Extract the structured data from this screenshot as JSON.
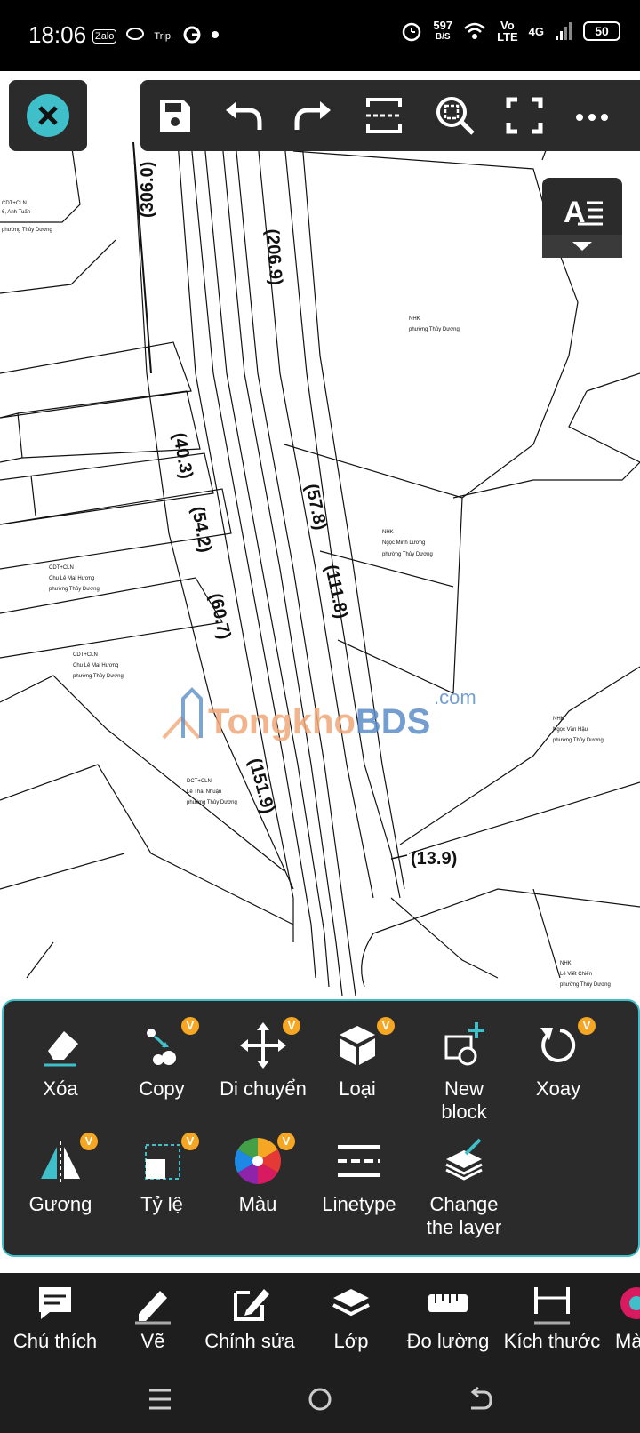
{
  "status_bar": {
    "time": "18:06",
    "apps": [
      "Zalo",
      "Trip."
    ],
    "net_speed_value": "597",
    "net_speed_unit": "B/S",
    "carrier_top": "Vo",
    "carrier_bottom": "LTE",
    "network": "4G",
    "battery": "50"
  },
  "toolbar": {
    "icons": [
      "save-icon",
      "undo-icon",
      "redo-icon",
      "select-area-icon",
      "zoom-window-icon",
      "fullscreen-icon",
      "more-icon"
    ]
  },
  "drawing": {
    "dimension_labels": [
      "(306.0)",
      "(206.9)",
      "(40.3)",
      "(54.2)",
      "(57.8)",
      "(111.8)",
      "(60.7)",
      "(151.9)",
      "(13.9)"
    ]
  },
  "watermark": {
    "brand_left": "Tongkho",
    "brand_right": "BDS",
    "domain": ".com"
  },
  "edit_panel": {
    "row1": [
      {
        "label": "Xóa",
        "icon": "eraser-icon",
        "v": false
      },
      {
        "label": "Copy",
        "icon": "copy-icon",
        "v": true,
        "badge": "V"
      },
      {
        "label": "Di chuyển",
        "icon": "move-icon",
        "v": true,
        "badge": "V"
      },
      {
        "label": "Loại",
        "icon": "explode-icon",
        "v": true,
        "badge": "V"
      },
      {
        "label": "New block",
        "icon": "new-block-icon",
        "v": false
      },
      {
        "label": "Xoay",
        "icon": "rotate-icon",
        "v": true,
        "badge": "V"
      }
    ],
    "row2": [
      {
        "label": "Gương",
        "icon": "mirror-icon",
        "v": true,
        "badge": "V"
      },
      {
        "label": "Tỷ lệ",
        "icon": "scale-icon",
        "v": true,
        "badge": "V"
      },
      {
        "label": "Màu",
        "icon": "color-wheel-icon",
        "v": true,
        "badge": "V"
      },
      {
        "label": "Linetype",
        "icon": "linetype-icon",
        "v": false
      },
      {
        "label": "Change the layer",
        "icon": "change-layer-icon",
        "v": false
      }
    ]
  },
  "bottom_nav": [
    {
      "label": "Chú thích",
      "icon": "comment-icon"
    },
    {
      "label": "Vẽ",
      "icon": "pencil-icon"
    },
    {
      "label": "Chỉnh sửa",
      "icon": "edit-icon"
    },
    {
      "label": "Lớp",
      "icon": "layers-icon"
    },
    {
      "label": "Đo lường",
      "icon": "ruler-icon"
    },
    {
      "label": "Kích thước",
      "icon": "dimension-icon"
    },
    {
      "label": "Mà",
      "icon": "color-icon"
    }
  ],
  "colors": {
    "accent": "#3ebfc9",
    "badge": "#f5a623",
    "panel_bg": "#2b2b2b",
    "nav_bg": "#1e1e1e"
  }
}
